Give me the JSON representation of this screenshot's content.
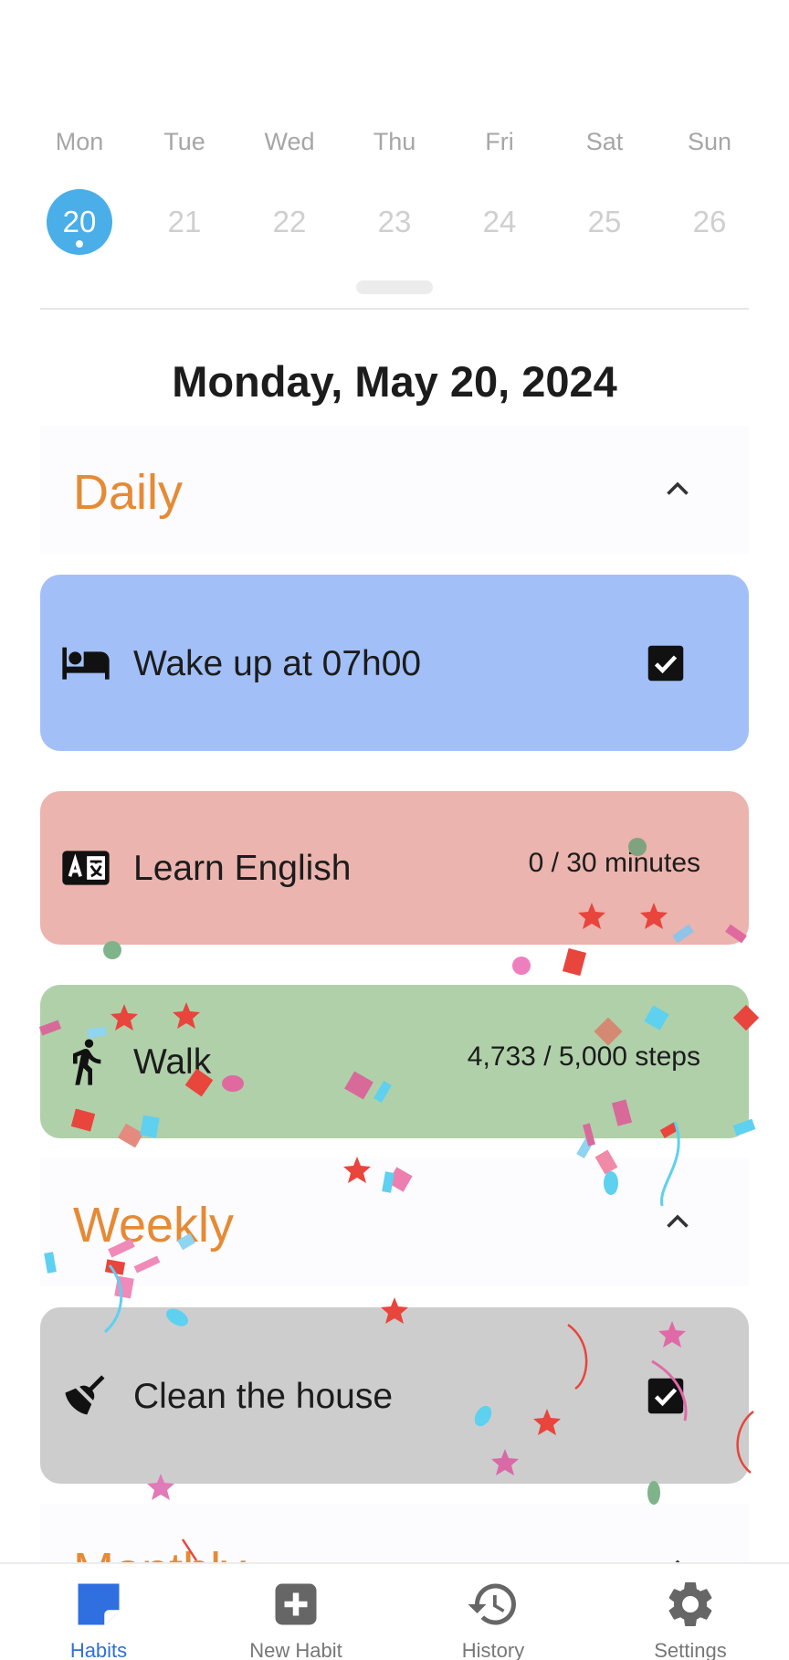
{
  "week": {
    "days": [
      "Mon",
      "Tue",
      "Wed",
      "Thu",
      "Fri",
      "Sat",
      "Sun"
    ],
    "dates": [
      "20",
      "21",
      "22",
      "23",
      "24",
      "25",
      "26"
    ],
    "selected_index": 0
  },
  "date_title": "Monday, May 20, 2024",
  "sections": {
    "daily": {
      "title": "Daily",
      "icon": "chevron-up-icon"
    },
    "weekly": {
      "title": "Weekly",
      "icon": "chevron-up-icon"
    },
    "monthly": {
      "title": "Monthly",
      "icon": "chevron-up-icon"
    }
  },
  "habits": {
    "wake": {
      "label": "Wake up at 07h00",
      "icon": "bed-icon",
      "color": "#a2c0f7",
      "checked": true
    },
    "english": {
      "label": "Learn English",
      "icon": "translate-icon",
      "progress": "0 / 30 minutes",
      "color": "#ebb4ae"
    },
    "walk": {
      "label": "Walk",
      "icon": "walk-icon",
      "progress": "4,733 / 5,000 steps",
      "color": "#b0d0aa"
    },
    "clean": {
      "label": "Clean the house",
      "icon": "broom-icon",
      "color": "#cdcdcd",
      "checked": true
    }
  },
  "nav": {
    "habits": "Habits",
    "new_habit": "New Habit",
    "history": "History",
    "settings": "Settings"
  },
  "colors": {
    "accent": "#4aaee8",
    "section_title": "#e58a35",
    "nav_active": "#2f6fdf"
  }
}
